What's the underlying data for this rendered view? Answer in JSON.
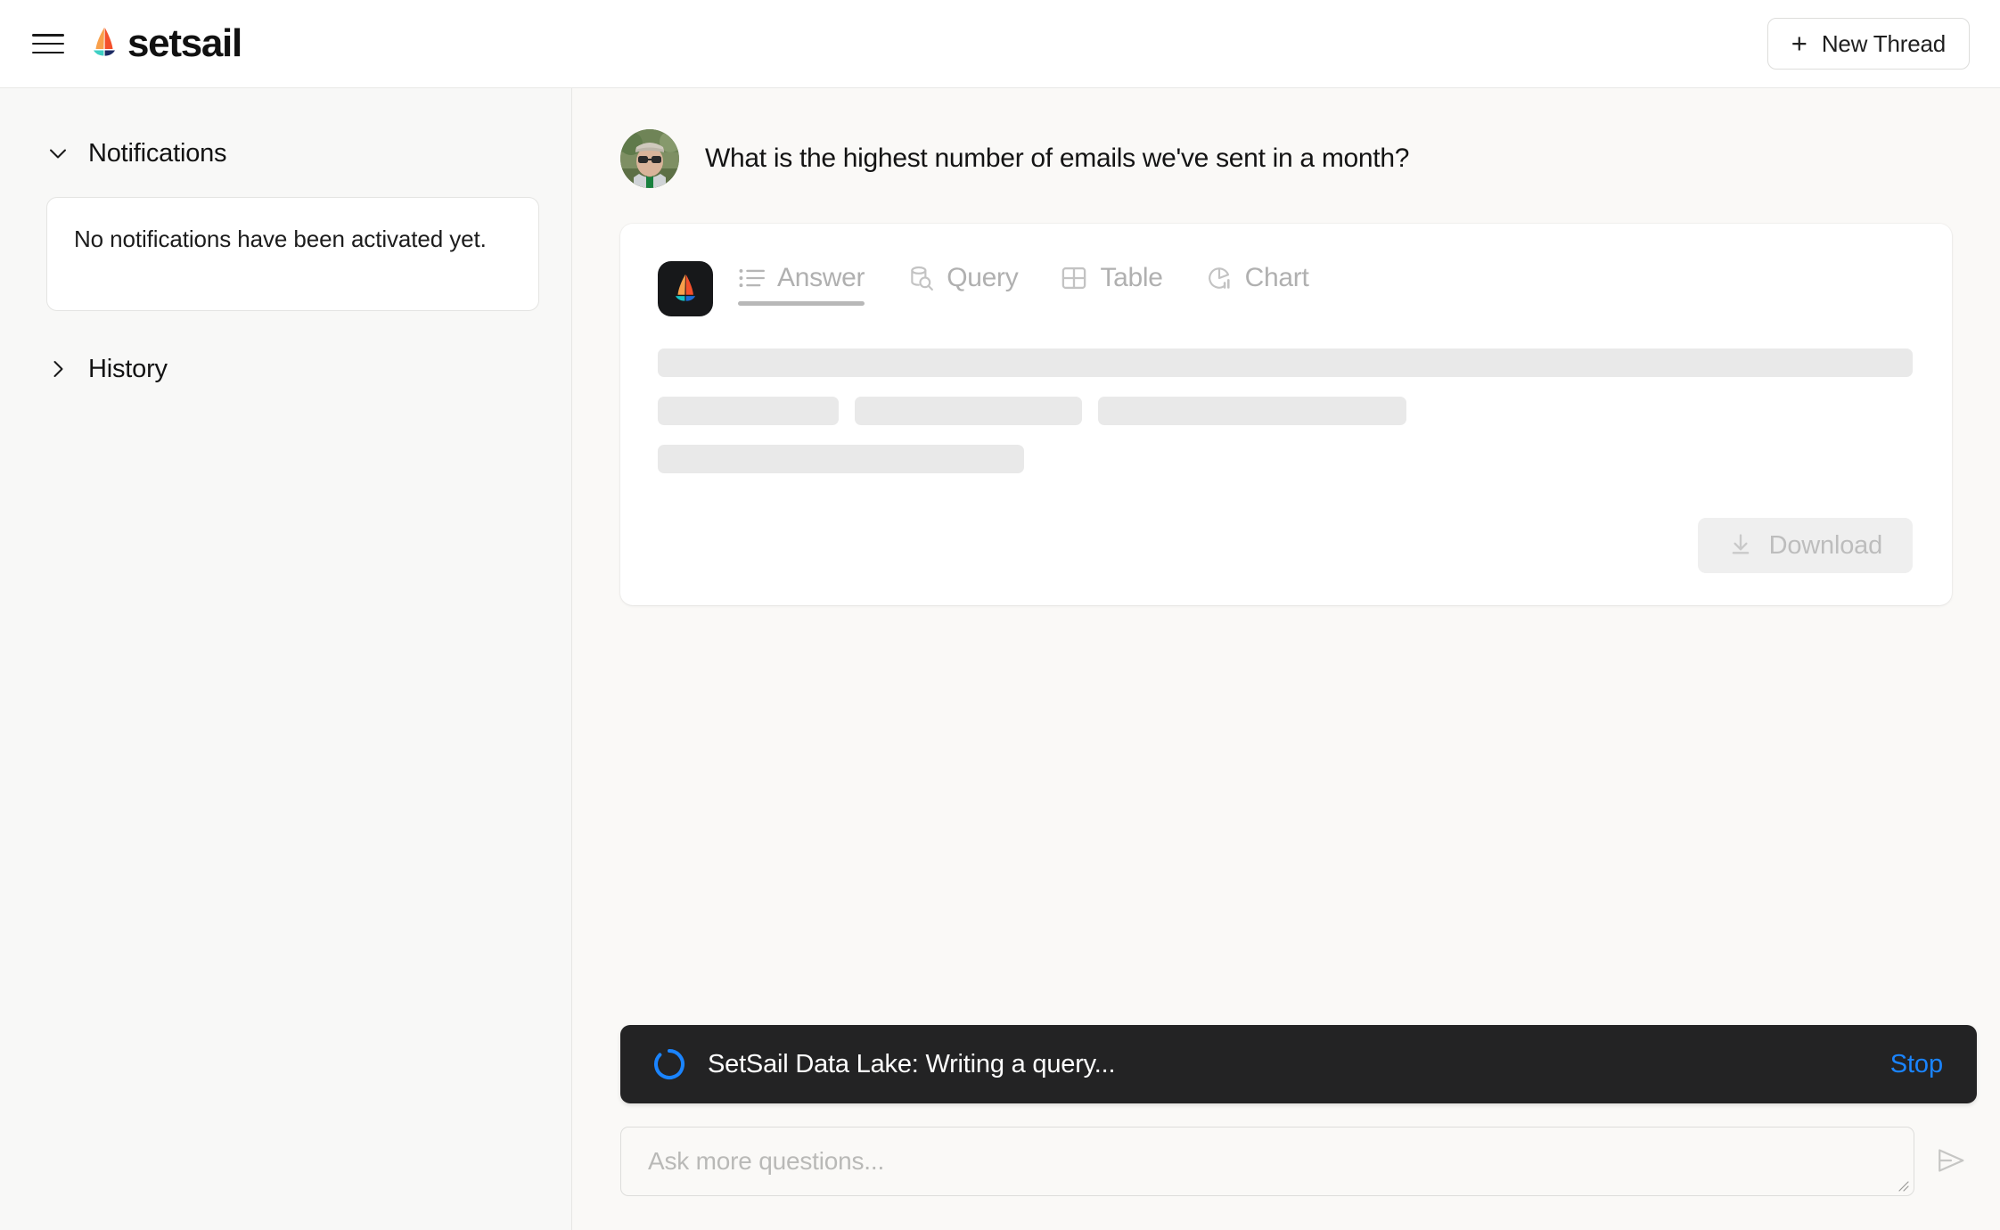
{
  "topbar": {
    "menu_icon": "hamburger-menu-icon",
    "logo_icon": "setsail-sailboat-logo-icon",
    "brand_name": "setsail",
    "new_thread": {
      "plus": "+",
      "label": "New Thread"
    }
  },
  "sidebar": {
    "sections": [
      {
        "label": "Notifications",
        "expanded": true,
        "chevron_icon": "chevron-down-icon",
        "empty_message": "No notifications have been activated yet."
      },
      {
        "label": "History",
        "expanded": false,
        "chevron_icon": "chevron-right-icon"
      }
    ]
  },
  "thread": {
    "user_message": {
      "avatar_icon": "user-avatar-photo",
      "text": "What is the highest number of emails we've sent in a month?"
    },
    "answer_card": {
      "bot_avatar_icon": "setsail-bot-avatar-icon",
      "tabs": [
        {
          "label": "Answer",
          "icon": "list-bullets-icon",
          "active": true
        },
        {
          "label": "Query",
          "icon": "database-search-icon",
          "active": false
        },
        {
          "label": "Table",
          "icon": "grid-table-icon",
          "active": false
        },
        {
          "label": "Chart",
          "icon": "pie-bar-chart-icon",
          "active": false
        }
      ],
      "loading_skeleton": {
        "rows": [
          [
            100
          ],
          [
            14.4,
            18.1,
            24.6
          ],
          [
            29.2
          ]
        ]
      },
      "download": {
        "label": "Download",
        "icon": "download-arrow-icon",
        "disabled": true
      }
    }
  },
  "status_toast": {
    "spinner_icon": "loading-spinner-icon",
    "message": "SetSail Data Lake: Writing a query...",
    "stop_label": "Stop"
  },
  "composer": {
    "placeholder": "Ask more questions...",
    "value": "",
    "send_icon": "send-paper-plane-icon",
    "resize_icon": "resize-grip-icon"
  },
  "colors": {
    "accent_orange": "#F9943B",
    "accent_red": "#F4502B",
    "accent_teal": "#2BC6C6",
    "accent_navy": "#1B2A63",
    "link_blue": "#1A84FF",
    "toast_bg": "#232324",
    "sidebar_bg": "#F8F8F7",
    "main_bg": "#FAF9F7"
  }
}
